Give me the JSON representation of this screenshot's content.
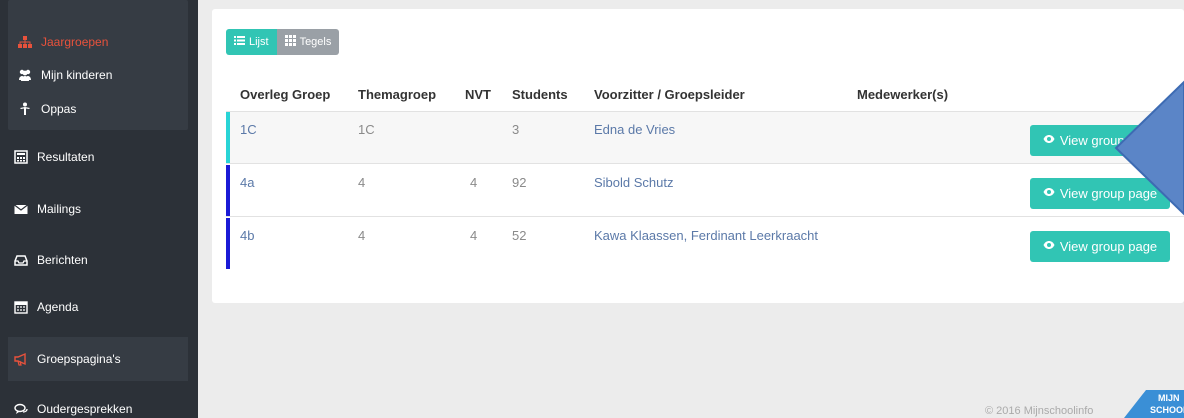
{
  "sidebar": {
    "items": [
      {
        "label": "Jaargroepen",
        "icon": "sitemap-icon"
      },
      {
        "label": "Mijn kinderen",
        "icon": "users-icon"
      },
      {
        "label": "Oppas",
        "icon": "child-icon"
      },
      {
        "label": "Resultaten",
        "icon": "calculator-icon"
      },
      {
        "label": "Mailings",
        "icon": "envelope-icon"
      },
      {
        "label": "Berichten",
        "icon": "inbox-icon"
      },
      {
        "label": "Agenda",
        "icon": "calendar-icon"
      },
      {
        "label": "Groepspagina's",
        "icon": "bullhorn-icon"
      },
      {
        "label": "Oudergesprekken",
        "icon": "comments-icon"
      }
    ]
  },
  "view_toggle": {
    "list_label": "Lijst",
    "tiles_label": "Tegels"
  },
  "table": {
    "headers": [
      "Overleg Groep",
      "Themagroep",
      "NVT",
      "Students",
      "Voorzitter / Groepsleider",
      "Medewerker(s)"
    ],
    "rows": [
      {
        "group": "1C",
        "theme": "1C",
        "nvt": "",
        "students": "3",
        "leader": "Edna de Vries",
        "staff": "",
        "button": "View group page",
        "accent": "#29d4d6"
      },
      {
        "group": "4a",
        "theme": "4",
        "nvt": "4",
        "students": "92",
        "leader": "Sibold Schutz",
        "staff": "",
        "button": "View group page",
        "accent": "#1a1ad6"
      },
      {
        "group": "4b",
        "theme": "4",
        "nvt": "4",
        "students": "52",
        "leader": "Kawa Klaassen, Ferdinant Leerkraacht",
        "staff": "",
        "button": "View group page",
        "accent": "#1a1ad6"
      }
    ]
  },
  "footer": {
    "copyright": "© 2016 Mijnschoolinfo",
    "logo_top": "MIJN",
    "logo_bottom": "SCHOOL"
  },
  "colors": {
    "accent": "#31c5b4",
    "active": "#e8523c",
    "sidebar": "#2c3138"
  }
}
